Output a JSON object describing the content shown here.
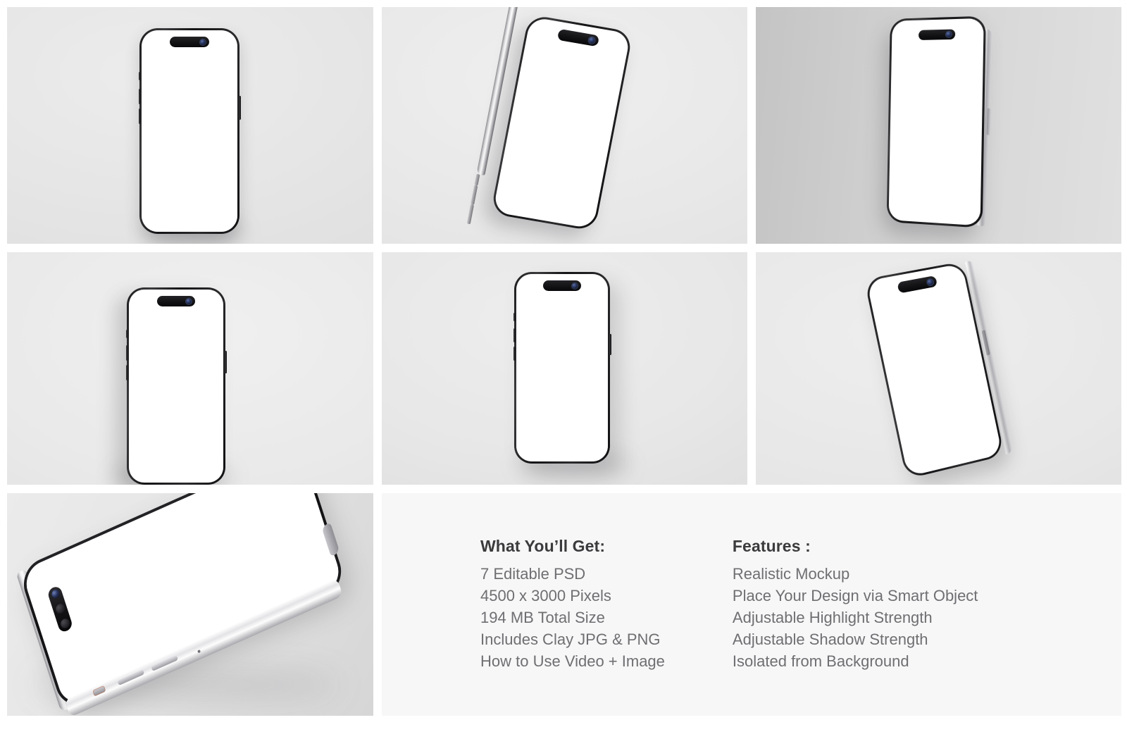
{
  "page": {
    "background": "#ffffff",
    "gutter_color": "#ffffff"
  },
  "gallery": {
    "cells": [
      {
        "id": "cell-1",
        "name": "phone-front-straight",
        "background": "#e6e6e6",
        "label": "iPhone front view on light grey backdrop"
      },
      {
        "id": "cell-2",
        "name": "phone-tilted-three-quarter",
        "background": "#e8e8e8",
        "label": "iPhone tilted three quarter view"
      },
      {
        "id": "cell-3",
        "name": "phone-perspective-right-edge",
        "background": "#cdcdcd",
        "label": "iPhone perspective view showing right metal edge"
      },
      {
        "id": "cell-4",
        "name": "phone-front-left-shadow",
        "background": "#e7e7e7",
        "label": "iPhone front view with left side shadow"
      },
      {
        "id": "cell-5",
        "name": "phone-front-centered",
        "background": "#e9e9e9",
        "label": "iPhone front view centered"
      },
      {
        "id": "cell-6",
        "name": "phone-tilted-right",
        "background": "#e7e7e7",
        "label": "iPhone tilted to the right"
      },
      {
        "id": "cell-7",
        "name": "phone-laid-flat",
        "background": "#e2e2e2",
        "label": "iPhone laid flat showing side buttons"
      }
    ]
  },
  "info": {
    "background": "#f7f7f7",
    "columns": [
      {
        "name": "what-you-will-get",
        "heading": "What You’ll Get:",
        "items": [
          "7 Editable PSD",
          "4500 x 3000 Pixels",
          "194 MB Total Size",
          "Includes Clay JPG & PNG",
          "How to Use Video + Image"
        ]
      },
      {
        "name": "features",
        "heading": "Features :",
        "items": [
          "Realistic Mockup",
          "Place Your Design via Smart Object",
          "Adjustable Highlight Strength",
          "Adjustable Shadow Strength",
          "Isolated from Background"
        ]
      }
    ]
  },
  "colors": {
    "heading_text": "#3b3b3d",
    "body_text": "#6f6f73",
    "screen": "#ffffff",
    "bezel": "#141416",
    "metal": "#d4d4d6"
  }
}
